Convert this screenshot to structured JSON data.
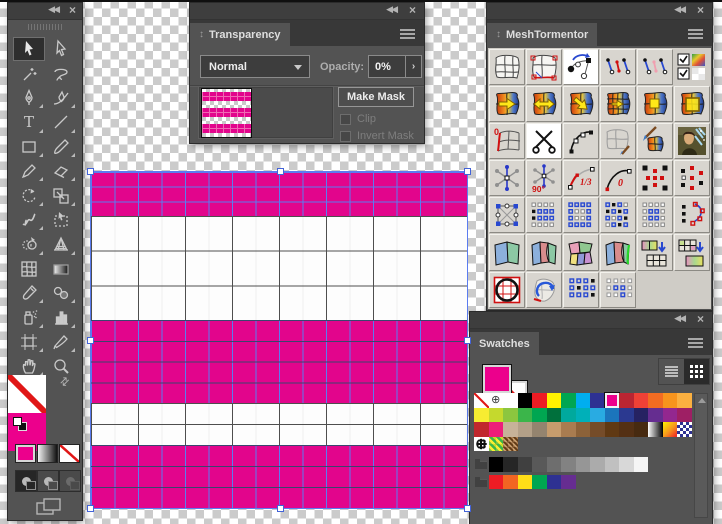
{
  "colors": {
    "accent_magenta": "#ec008c",
    "artwork_magenta": "#e2058c",
    "mesh_line_blue": "#5b7cf0",
    "panel_bg": "#535353",
    "panel_header": "#3e3e3e",
    "mt_button_bg": "#d8d5cf",
    "checker_gray": "#cbcbcb"
  },
  "toolbar": {
    "tools": [
      "selection",
      "direct-selection",
      "magic-wand",
      "lasso",
      "pen",
      "curvature",
      "type",
      "line-segment",
      "rectangle",
      "paintbrush",
      "pencil",
      "eraser",
      "rotate",
      "scale",
      "warp",
      "free-transform",
      "shape-builder",
      "perspective-grid",
      "mesh",
      "gradient",
      "eyedropper",
      "blend",
      "symbol-sprayer",
      "column-graph",
      "artboard",
      "slice",
      "hand",
      "zoom"
    ],
    "fill_color": "#ec008c",
    "stroke_color": "none",
    "color_buttons": [
      "color",
      "gradient",
      "none"
    ],
    "drawing_modes": [
      "draw-normal",
      "draw-behind",
      "draw-inside"
    ],
    "screen_mode": "change-screen-mode"
  },
  "transparency": {
    "title": "Transparency",
    "blend_mode": "Normal",
    "opacity_label": "Opacity:",
    "opacity_value": "0%",
    "opacity_step_button": "›",
    "make_mask_label": "Make Mask",
    "clip_label": "Clip",
    "invert_mask_label": "Invert Mask"
  },
  "meshtormentor": {
    "title": "MeshTormentor",
    "buttons": [
      "mesh-outline",
      "mesh-anchors-selected",
      "convert-anchor",
      "handle-pair-red",
      "handle-pair-pink",
      "mesh-options-checkboxes",
      "mesh-blob-arrow-right",
      "mesh-blob-arrow-both",
      "mesh-blob-arrow-corner",
      "mesh-blob-grid",
      "mesh-blob-square-filled",
      "mesh-blob-square-outline",
      "mesh-zero-edge",
      "scissors-cut",
      "path-anchors",
      "mesh-outline-brush",
      "brush-mesh-paint",
      "mona-lisa-sample",
      "handles-star",
      "handles-star-90",
      "handle-one-third",
      "handle-zero",
      "anchor-pattern-inner",
      "anchor-pattern-outer",
      "mesh-cell-nodes",
      "select-grid-all",
      "select-grid-ring",
      "select-grid-alternate",
      "select-grid-sparse",
      "anchors-along-curve",
      "patch-two-color",
      "patch-three-color",
      "patch-multi-color",
      "patch-edge-highlight",
      "mesh-to-grid-convert",
      "grid-to-mesh-convert",
      "circle-grid-red",
      "rotate-mesh",
      "grid-select-center",
      "grid-select-few"
    ]
  },
  "swatches": {
    "title": "Swatches",
    "fill": "#ec008c",
    "stroke": "none",
    "view_buttons": [
      "list-view",
      "grid-view"
    ],
    "selected": {
      "row": 0,
      "col": 9
    },
    "rows": [
      [
        "none",
        "registration",
        "#ffffff",
        "#000000",
        "#ed1c24",
        "#fff200",
        "#00a651",
        "#00aeef",
        "#2e3192",
        "#ec008c",
        "#bb2532",
        "#ef4136",
        "#f26c22",
        "#f7941d",
        "#fbb040"
      ],
      [
        "#f7ec31",
        "#c5d92d",
        "#8cc63f",
        "#3bb54a",
        "#00a651",
        "#00703c",
        "#00a99d",
        "#00b0b9",
        "#29abe2",
        "#1b75bc",
        "#2b3990",
        "#262262",
        "#652d90",
        "#93278f",
        "#9e1f64"
      ],
      [
        "#c1272d",
        "#ed1e79",
        "#c7b299",
        "#b3a088",
        "#94846f",
        "#c69c6d",
        "#a97c50",
        "#8c6239",
        "#754c29",
        "#603913",
        "#543014",
        "#472a10",
        "grad-bw",
        "grad-sunset",
        "pattern-check-blue"
      ],
      [
        "pattern-dots",
        "pattern-green",
        "pattern-brown"
      ],
      [
        "folder",
        "#000000",
        "#262626",
        "#404040",
        "#595959",
        "#6e6e6e",
        "#828282",
        "#969696",
        "#ababab",
        "#c0c0c0",
        "#d8d8d8",
        "#f5f5f5"
      ],
      [
        "folder",
        "#ed1c24",
        "#f26522",
        "#ffde17",
        "#00a651",
        "#2e3192",
        "#662d91"
      ]
    ]
  }
}
